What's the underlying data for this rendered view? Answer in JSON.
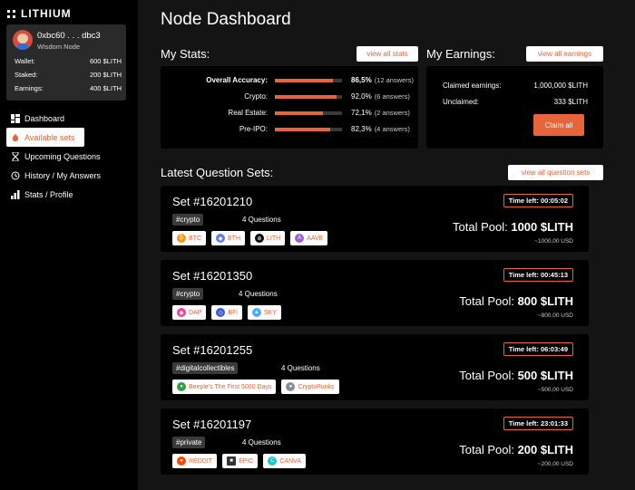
{
  "app": {
    "logo_text": "LITHIUM"
  },
  "user": {
    "address": "0xbc60 . . . dbc3",
    "role": "Wisdom Node",
    "wallet_label": "Wallet:",
    "wallet_value": "600 $LITH",
    "staked_label": "Staked:",
    "staked_value": "200 $LITH",
    "earnings_label": "Earnings:",
    "earnings_value": "400 $LITH"
  },
  "nav": [
    {
      "label": "Dashboard",
      "icon": "dashboard-icon",
      "active": false
    },
    {
      "label": "Available sets",
      "icon": "flame-icon",
      "active": true
    },
    {
      "label": "Upcoming Questions",
      "icon": "hourglass-icon",
      "active": false
    },
    {
      "label": "History / My Answers",
      "icon": "history-icon",
      "active": false
    },
    {
      "label": "Stats / Profile",
      "icon": "bar-chart-icon",
      "active": false
    }
  ],
  "main": {
    "title": "Node Dashboard",
    "stats": {
      "title": "My Stats:",
      "view_all": "view all stats",
      "rows": [
        {
          "label": "Overall Accuracy:",
          "pct": "86,5%",
          "fill": 0.865,
          "count": "(12 answers)",
          "bold": true
        },
        {
          "label": "Crypto:",
          "pct": "92,0%",
          "fill": 0.92,
          "count": "(6 answers)",
          "bold": false
        },
        {
          "label": "Real Estate:",
          "pct": "72,1%",
          "fill": 0.721,
          "count": "(2 answers)",
          "bold": false
        },
        {
          "label": "Pre-IPO:",
          "pct": "82,3%",
          "fill": 0.823,
          "count": "(4 answers)",
          "bold": false
        }
      ]
    },
    "earnings": {
      "title": "My Earnings:",
      "view_all": "view all earnings",
      "claimed_label": "Claimed earnings:",
      "claimed_value": "1,000,000 $LITH",
      "unclaimed_label": "Unclaimed:",
      "unclaimed_value": "333 $LITH",
      "claim_button": "Claim all"
    },
    "sets_title": "Latest Question Sets:",
    "sets_view_all": "view all question sets",
    "sets": [
      {
        "title": "Set #16201210",
        "tag": "#crypto",
        "questions": "4 Questions",
        "time": "Time left: 00:05:02",
        "pool_label": "Total Pool:",
        "pool_value": "1000 $LITH",
        "usd": "~1000,00 USD",
        "tokens": [
          {
            "label": "BTC",
            "color": "#f7931a",
            "glyph": "₿"
          },
          {
            "label": "ETH",
            "color": "#627eea",
            "glyph": "◆"
          },
          {
            "label": "LITH",
            "color": "#000000",
            "glyph": "⊕"
          },
          {
            "label": "AAVE",
            "color": "#9b5fcf",
            "glyph": "A"
          }
        ]
      },
      {
        "title": "Set #16201350",
        "tag": "#crypto",
        "questions": "4 Questions",
        "time": "Time left: 00:45:13",
        "pool_label": "Total Pool:",
        "pool_value": "800 $LITH",
        "usd": "~800,00 USD",
        "tokens": [
          {
            "label": "DAP",
            "color": "#e84393",
            "glyph": "◉"
          },
          {
            "label": "BFi",
            "color": "#3b5bdb",
            "glyph": "◇"
          },
          {
            "label": "SKY",
            "color": "#4dabf7",
            "glyph": "▲"
          }
        ]
      },
      {
        "title": "Set #16201255",
        "tag": "#digitalcollectibles",
        "questions": "4 Questions",
        "time": "Time left: 06:03:49",
        "pool_label": "Total Pool:",
        "pool_value": "500 $LITH",
        "usd": "~500,00 USD",
        "tokens": [
          {
            "label": "Beeple's The First 5000 Days",
            "color": "#2f9e44",
            "glyph": "●"
          },
          {
            "label": "CryptoPunks",
            "color": "#868e96",
            "glyph": "●"
          }
        ]
      },
      {
        "title": "Set #16201197",
        "tag": "#private",
        "questions": "4 Questions",
        "time": "Time left: 23:01:33",
        "pool_label": "Total Pool:",
        "pool_value": "200 $LITH",
        "usd": "~200,00 USD",
        "tokens": [
          {
            "label": "REDDIT",
            "color": "#ff4500",
            "glyph": "●"
          },
          {
            "label": "EPIC",
            "color": "#333333",
            "glyph": "■"
          },
          {
            "label": "CANVA",
            "color": "#20c4cb",
            "glyph": "C"
          }
        ]
      }
    ]
  },
  "colors": {
    "accent": "#e8643a",
    "panel": "#000000",
    "main_bg": "#141414"
  }
}
